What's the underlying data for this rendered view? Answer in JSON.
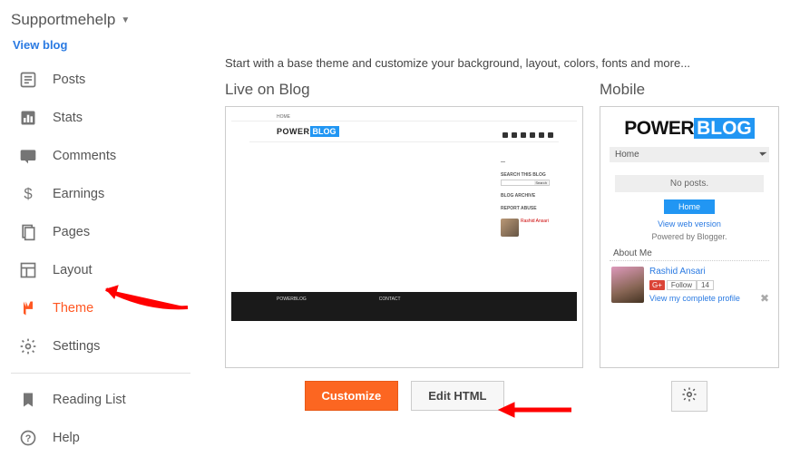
{
  "header": {
    "blog_name": "Supportmehelp",
    "view_blog": "View blog"
  },
  "nav": {
    "posts": "Posts",
    "stats": "Stats",
    "comments": "Comments",
    "earnings": "Earnings",
    "pages": "Pages",
    "layout": "Layout",
    "theme": "Theme",
    "settings": "Settings",
    "reading_list": "Reading List",
    "help": "Help"
  },
  "main": {
    "intro": "Start with a base theme and customize your background, layout, colors, fonts and more...",
    "live_label": "Live on Blog",
    "mobile_label": "Mobile",
    "customize": "Customize",
    "edit_html": "Edit HTML"
  },
  "preview": {
    "logo_a": "POWER",
    "logo_b": "BLOG",
    "home": "Home",
    "desktop_topnav": "HOME",
    "search_label": "SEARCH THIS BLOG",
    "archive_label": "BLOG ARCHIVE",
    "report_label": "REPORT ABUSE",
    "footer1": "POWERBLOG",
    "footer2": "CONTACT",
    "profile_name": "Rashid Ansari",
    "no_posts": "No posts.",
    "view_web": "View web version",
    "powered": "Powered by Blogger.",
    "about_me": "About Me",
    "follow": "Follow",
    "follow_count": "14",
    "complete_profile": "View my complete profile"
  }
}
